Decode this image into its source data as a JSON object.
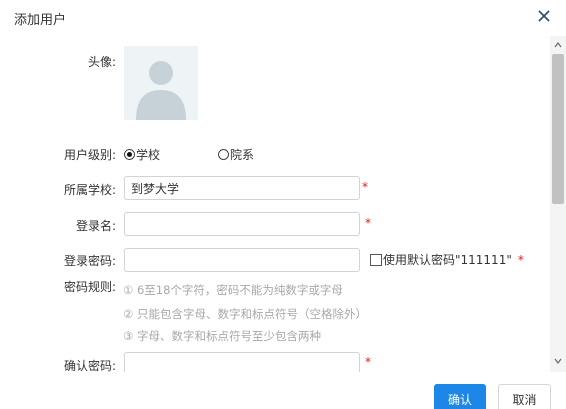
{
  "dialog": {
    "title": "添加用户",
    "close_icon": "close-icon"
  },
  "form": {
    "avatar": {
      "label": "头像:",
      "icon": "user-avatar-icon"
    },
    "user_level": {
      "label": "用户级别:",
      "options": [
        {
          "label": "学校",
          "checked": true
        },
        {
          "label": "院系",
          "checked": false
        }
      ]
    },
    "school": {
      "label": "所属学校:",
      "value": "到梦大学",
      "required_mark": "*"
    },
    "login_name": {
      "label": "登录名:",
      "value": "",
      "required_mark": "*"
    },
    "password": {
      "label": "登录密码:",
      "value": "",
      "use_default_label": "使用默认密码\"111111\"",
      "use_default_checked": false,
      "required_mark": "*"
    },
    "password_rules": {
      "label": "密码规则:",
      "items": [
        "① 6至18个字符，密码不能为纯数字或字母",
        "② 只能包含字母、数字和标点符号（空格除外）",
        "③ 字母、数字和标点符号至少包含两种"
      ]
    },
    "confirm_password": {
      "label": "确认密码:",
      "value": "",
      "required_mark": "*"
    }
  },
  "footer": {
    "confirm_label": "确认",
    "cancel_label": "取消"
  },
  "colors": {
    "primary": "#1c87e6",
    "required": "#e02020",
    "hint_text": "#a8a8a8",
    "input_border": "#cfd4d8"
  }
}
